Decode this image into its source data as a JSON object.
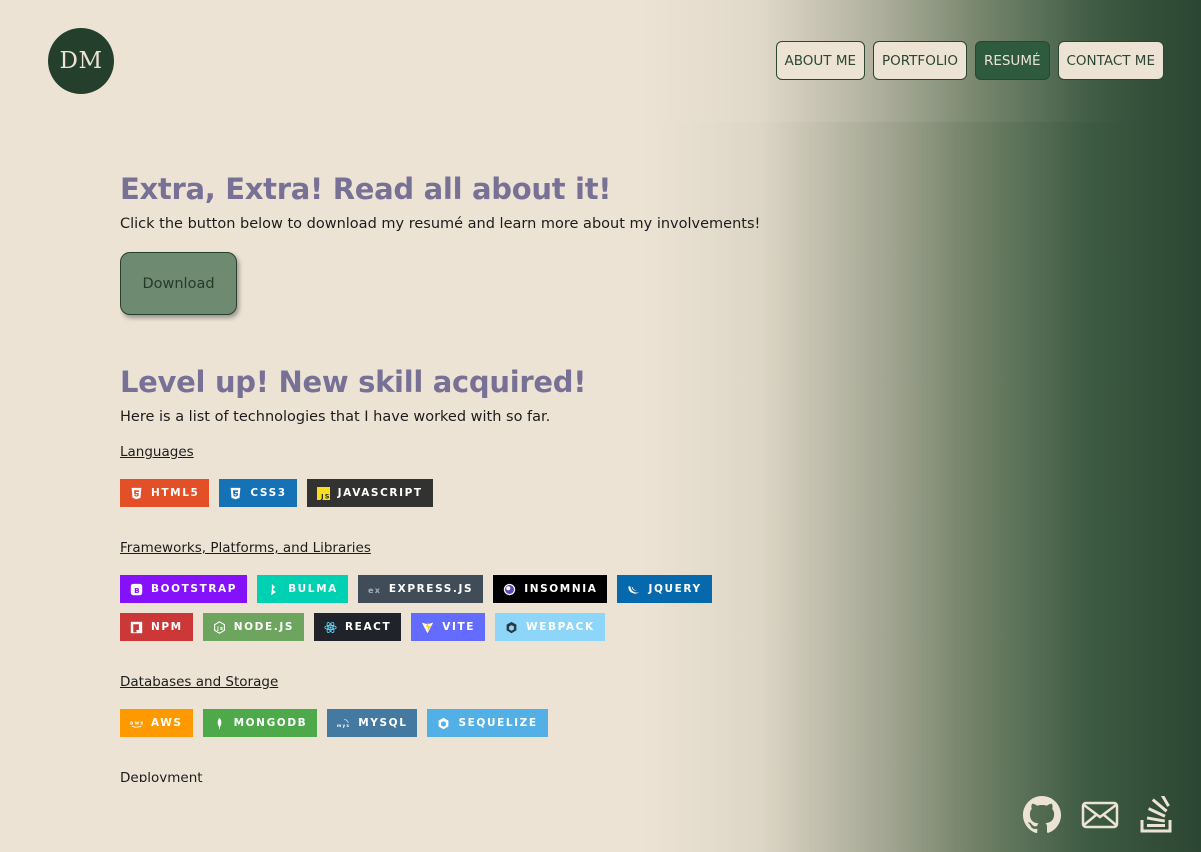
{
  "logo": {
    "text": "DM"
  },
  "nav": {
    "items": [
      {
        "label": "ABOUT ME"
      },
      {
        "label": "PORTFOLIO"
      },
      {
        "label": "RESUMÉ"
      },
      {
        "label": "CONTACT ME"
      }
    ],
    "active_index": 2
  },
  "resume": {
    "heading": "Extra, Extra! Read all about it!",
    "text": "Click the button below to download my resumé and learn more about my involvements!",
    "download_label": "Download"
  },
  "skills": {
    "heading": "Level up! New skill acquired!",
    "text": "Here is a list of technologies that I have worked with so far.",
    "categories": [
      {
        "title": "Languages",
        "badges": [
          {
            "label": "HTML5",
            "color": "#e34f26",
            "icon": "html5-icon"
          },
          {
            "label": "CSS3",
            "color": "#1572b6",
            "icon": "css3-icon"
          },
          {
            "label": "JAVASCRIPT",
            "color": "#323330",
            "icon": "javascript-icon"
          }
        ]
      },
      {
        "title": "Frameworks, Platforms, and Libraries",
        "badges": [
          {
            "label": "BOOTSTRAP",
            "color": "#8511fa",
            "icon": "bootstrap-icon"
          },
          {
            "label": "BULMA",
            "color": "#00d1b2",
            "icon": "bulma-icon"
          },
          {
            "label": "EXPRESS.JS",
            "color": "#404d59",
            "icon": "express-icon"
          },
          {
            "label": "INSOMNIA",
            "color": "#000000",
            "icon": "insomnia-icon"
          },
          {
            "label": "JQUERY",
            "color": "#0769ad",
            "icon": "jquery-icon"
          },
          {
            "label": "NPM",
            "color": "#cb3837",
            "icon": "npm-icon"
          },
          {
            "label": "NODE.JS",
            "color": "#6da55f",
            "icon": "nodejs-icon"
          },
          {
            "label": "REACT",
            "color": "#20232a",
            "icon": "react-icon"
          },
          {
            "label": "VITE",
            "color": "#646cff",
            "icon": "vite-icon"
          },
          {
            "label": "WEBPACK",
            "color": "#8dd6f9",
            "icon": "webpack-icon"
          }
        ]
      },
      {
        "title": "Databases and Storage",
        "badges": [
          {
            "label": "AWS",
            "color": "#ff9900",
            "icon": "aws-icon"
          },
          {
            "label": "MONGODB",
            "color": "#4ea94b",
            "icon": "mongodb-icon"
          },
          {
            "label": "MYSQL",
            "color": "#4479a1",
            "icon": "mysql-icon"
          },
          {
            "label": "SEQUELIZE",
            "color": "#52b0e7",
            "icon": "sequelize-icon"
          }
        ]
      },
      {
        "title": "Deployment",
        "badges": []
      }
    ]
  },
  "social": {
    "items": [
      {
        "icon": "github-icon"
      },
      {
        "icon": "mail-icon"
      },
      {
        "icon": "stackoverflow-icon"
      }
    ]
  },
  "colors": {
    "background": "#ede3d5",
    "accent_dark_green": "#2b4632",
    "heading": "#777196",
    "download_button": "#6e8b72"
  }
}
